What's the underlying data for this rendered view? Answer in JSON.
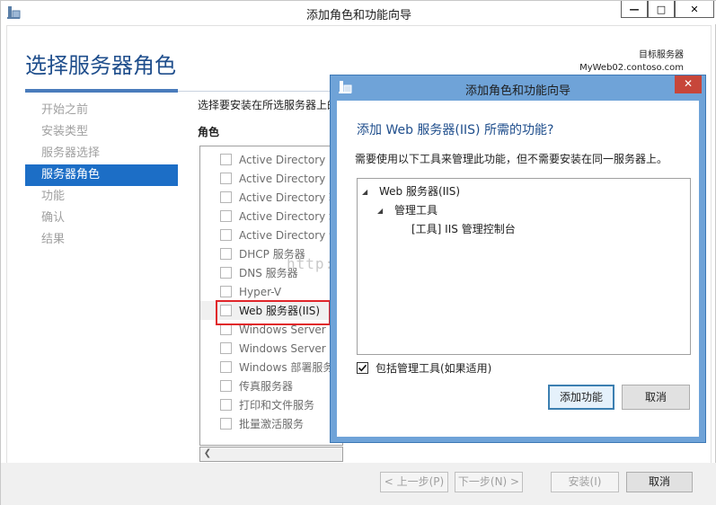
{
  "window": {
    "title": "添加角色和功能向导",
    "min_label": "—",
    "max_label": "□",
    "close_label": "✕"
  },
  "page": {
    "heading": "选择服务器角色",
    "destination_label": "目标服务器",
    "destination_server": "MyWeb02.contoso.com",
    "instruction": "选择要安装在所选服务器上的一个或多个角色。",
    "roles_label": "角色"
  },
  "steps": [
    {
      "label": "开始之前",
      "active": false
    },
    {
      "label": "安装类型",
      "active": false
    },
    {
      "label": "服务器选择",
      "active": false
    },
    {
      "label": "服务器角色",
      "active": true
    },
    {
      "label": "功能",
      "active": false
    },
    {
      "label": "确认",
      "active": false
    },
    {
      "label": "结果",
      "active": false
    }
  ],
  "roles": [
    {
      "label": "Active Directory Fe"
    },
    {
      "label": "Active Directory R"
    },
    {
      "label": "Active Directory 轻"
    },
    {
      "label": "Active Directory 域"
    },
    {
      "label": "Active Directory 证"
    },
    {
      "label": "DHCP 服务器"
    },
    {
      "label": "DNS 服务器"
    },
    {
      "label": "Hyper-V"
    },
    {
      "label": "Web 服务器(IIS)"
    },
    {
      "label": "Windows Server E"
    },
    {
      "label": "Windows Server 更"
    },
    {
      "label": "Windows 部署服务"
    },
    {
      "label": "传真服务器"
    },
    {
      "label": "打印和文件服务"
    },
    {
      "label": "批量激活服务"
    }
  ],
  "watermark": "http://blog.csdn.net/",
  "footer": {
    "prev": "< 上一步(P)",
    "next": "下一步(N) >",
    "install": "安装(I)",
    "cancel": "取消"
  },
  "dialog": {
    "title": "添加角色和功能向导",
    "close_label": "✕",
    "heading": "添加 Web 服务器(IIS) 所需的功能?",
    "description": "需要使用以下工具来管理此功能，但不需要安装在同一服务器上。",
    "tree": {
      "root": "Web 服务器(IIS)",
      "child": "管理工具",
      "leaf": "[工具] IIS 管理控制台"
    },
    "include_tools_label": "包括管理工具(如果适用)",
    "include_tools_checked": true,
    "add_button": "添加功能",
    "cancel_button": "取消"
  }
}
